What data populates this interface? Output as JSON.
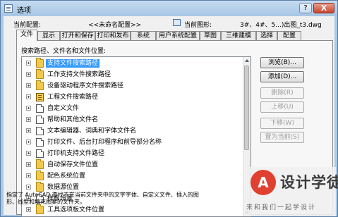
{
  "window": {
    "title": "选项",
    "help_label": "?",
    "close_label": "X"
  },
  "current_config": {
    "label": "当前配置:",
    "value": "<<未命名配置>>"
  },
  "current_drawing": {
    "label": "当前图形:",
    "value": "3#、4#、5...)出图_t3.dwg"
  },
  "tabs": [
    {
      "label": "文件",
      "active": true
    },
    {
      "label": "显示"
    },
    {
      "label": "打开和保存"
    },
    {
      "label": "打印和发布"
    },
    {
      "label": "系统"
    },
    {
      "label": "用户系统配置"
    },
    {
      "label": "草图"
    },
    {
      "label": "三维建模"
    },
    {
      "label": "选择"
    },
    {
      "label": "配置"
    }
  ],
  "search_paths_label": "搜索路径、文件名和文件位置:",
  "tree_items": [
    {
      "label": "支持文件搜索路径",
      "icon": "folder-icon",
      "selected": true
    },
    {
      "label": "工作支持文件搜索路径",
      "icon": "folder-icon"
    },
    {
      "label": "设备驱动程序文件搜索路径",
      "icon": "folder-icon"
    },
    {
      "label": "工程文件搜索路径",
      "icon": "book-icon"
    },
    {
      "label": "自定义文件",
      "icon": "document-icon"
    },
    {
      "label": "帮助和其他文件名",
      "icon": "document-icon"
    },
    {
      "label": "文本编辑器、词典和字体文件名",
      "icon": "document-icon"
    },
    {
      "label": "打印文件、后台打印程序和前导部分名称",
      "icon": "document-icon"
    },
    {
      "label": "打印机支持文件路径",
      "icon": "document-icon"
    },
    {
      "label": "自动保存文件位置",
      "icon": "folder-icon"
    },
    {
      "label": "配色系统位置",
      "icon": "folder-icon"
    },
    {
      "label": "数据源位置",
      "icon": "folder-icon"
    },
    {
      "label": "样板设置",
      "icon": "document-icon"
    },
    {
      "label": "工具选项板文件位置",
      "icon": "folder-icon"
    }
  ],
  "buttons": {
    "browse": "浏览(B)...",
    "add": "添加(D)...",
    "delete": "删除(R)",
    "move_up": "上移(U)",
    "move_down": "下移(W)",
    "set_current": "置为当前(S)"
  },
  "hint": {
    "line1": "指定了 AutoCAD 查找不在当前文件夹中的文字字体、自定义文件、插入的图",
    "line2": "形、线型和填充图案的文件夹。"
  },
  "watermark": {
    "title": "设计学徒",
    "tagline": "来和我们一起学设计"
  },
  "colors": {
    "selection": "#3399ff",
    "frame": "#a9c9e6",
    "close_button": "#c8432b"
  }
}
